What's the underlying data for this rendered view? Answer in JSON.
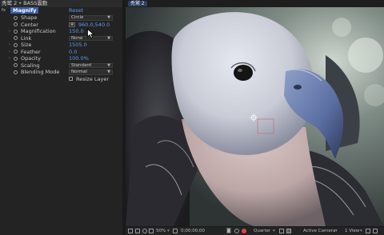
{
  "panel": {
    "title": "秃鹫 2 • BASS震動",
    "effect": {
      "tag": "fx",
      "name": "Magnify",
      "reset_label": "Reset"
    },
    "properties": [
      {
        "name": "Shape",
        "value": "Circle",
        "kind": "dropdown"
      },
      {
        "name": "Center",
        "value": "960.0,540.0",
        "kind": "point"
      },
      {
        "name": "Magnification",
        "value": "150.0",
        "kind": "number",
        "twirl": true,
        "stopwatch": true
      },
      {
        "name": "Link",
        "value": "None",
        "kind": "dropdown",
        "stopwatch": true
      },
      {
        "name": "Size",
        "value": "1505.0",
        "kind": "number",
        "twirl": true,
        "stopwatch": true
      },
      {
        "name": "Feather",
        "value": "0.0",
        "kind": "number",
        "twirl": true,
        "stopwatch": true
      },
      {
        "name": "Opacity",
        "value": "100.0%",
        "kind": "number",
        "twirl": true,
        "stopwatch": true
      },
      {
        "name": "Scaling",
        "value": "Standard",
        "kind": "dropdown",
        "stopwatch": true
      },
      {
        "name": "Blending Mode",
        "value": "Normal",
        "kind": "dropdown",
        "stopwatch": true
      }
    ],
    "checkbox": {
      "label": "Resize Layer",
      "checked": false
    }
  },
  "viewer": {
    "tab_label": "秃鹫 2"
  },
  "toolbar": {
    "zoom": "50%",
    "timecode": "0;00;00;00",
    "resolution": "Quarter",
    "camera": "Active Camera",
    "views": "1 View"
  },
  "colors": {
    "accent_blue": "#5c9bf0",
    "effect_highlight": "#3c5fa8",
    "panel_bg": "#232323"
  }
}
